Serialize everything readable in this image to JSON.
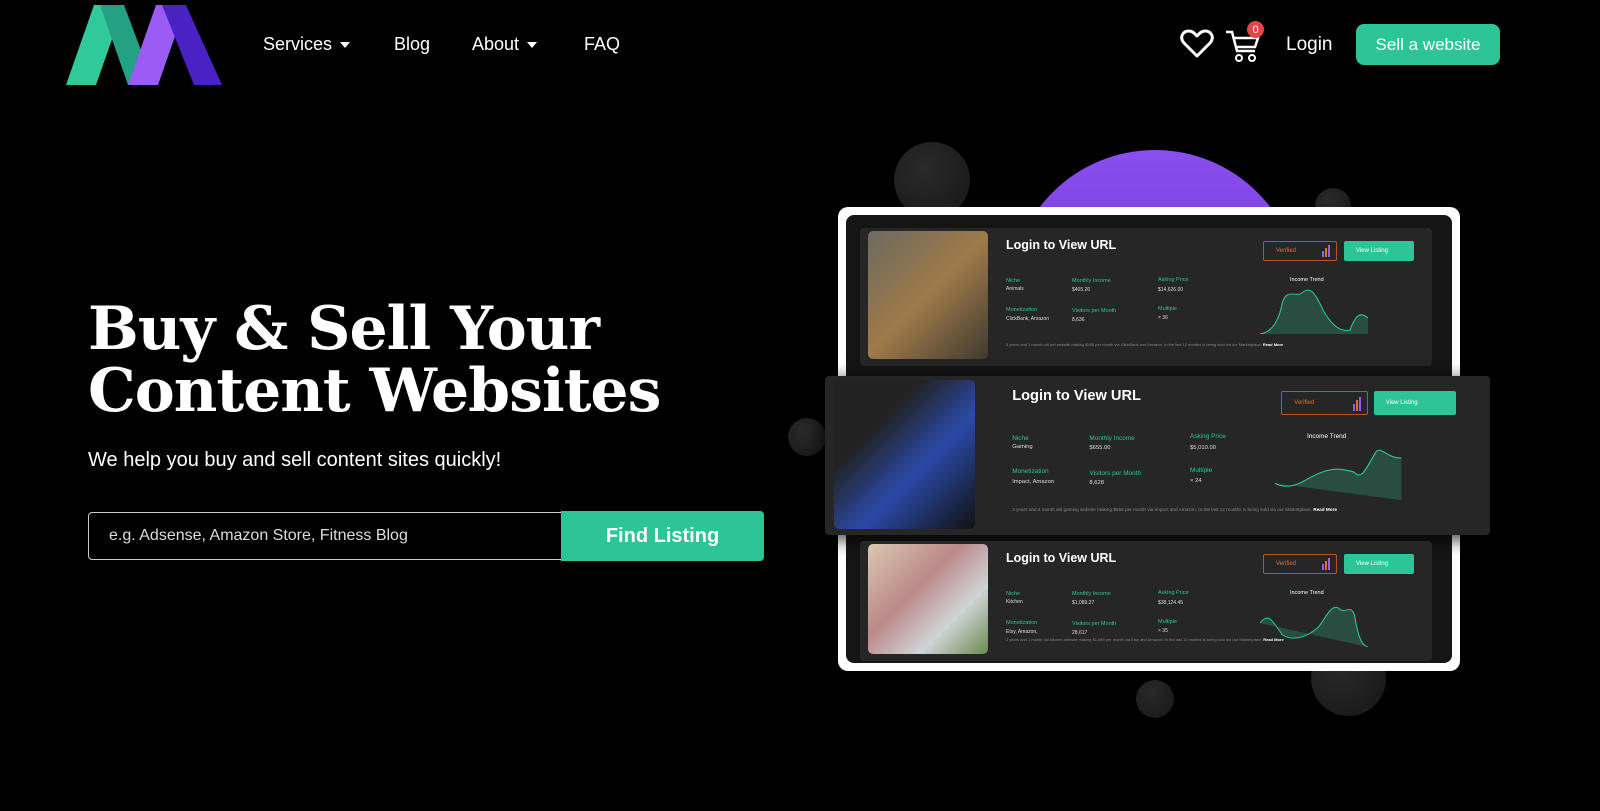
{
  "nav": {
    "items": [
      {
        "label": "Services",
        "dropdown": true
      },
      {
        "label": "Blog"
      },
      {
        "label": "About",
        "dropdown": true
      },
      {
        "label": "FAQ"
      }
    ],
    "cart_count": "0",
    "login": "Login",
    "sell": "Sell a website"
  },
  "hero": {
    "title": "Buy & Sell Your Content Websites",
    "subtitle": "We help you buy and sell content sites quickly!",
    "search_placeholder": "e.g. Adsense, Amazon Store, Fitness Blog",
    "find": "Find Listing"
  },
  "colors": {
    "accent": "#2dc597",
    "purple": "#8b4ef0",
    "verified": "#e0702e"
  },
  "labels": {
    "niche": "Niche",
    "monthly_income": "Monthly Income",
    "asking_price": "Asking Price",
    "monetization": "Monetization",
    "visitors": "Visitors per Month",
    "multiple": "Multiple",
    "trend": "Income Trend",
    "verified": "Verified",
    "view": "View Listing",
    "read_more": "Read More"
  },
  "listings": [
    {
      "title": "Login to View URL",
      "niche": "Animals",
      "income": "$405.26",
      "price": "$14,626.00",
      "monetization": "ClickBank, Amazon",
      "visitors": "8,636",
      "multiple": "36",
      "desc": "3 years and 1 month old pet website making $405 per month via ClickBank and Amazon. In the last 12 months is being sold via our Marketplace."
    },
    {
      "title": "Login to View URL",
      "niche": "Gaming",
      "income": "$655.00",
      "price": "$5,010.00",
      "monetization": "Impact, Amazon",
      "visitors": "8,628",
      "multiple": "24",
      "desc": "3 years and 4 month old gaming website making $655 per month via Impact and Amazon. In the last 12 months is being sold via our Marketplace."
    },
    {
      "title": "Login to View URL",
      "niche": "Kitchen",
      "income": "$1,089.27",
      "price": "$38,124.45",
      "monetization": "Etsy, Amazon,",
      "visitors": "28,617",
      "multiple": "35",
      "desc": "2 years and 1 month old kitchen website making $1,089 per month via Etsy and Amazon. In the last 12 months is being sold via our Marketplace."
    }
  ]
}
